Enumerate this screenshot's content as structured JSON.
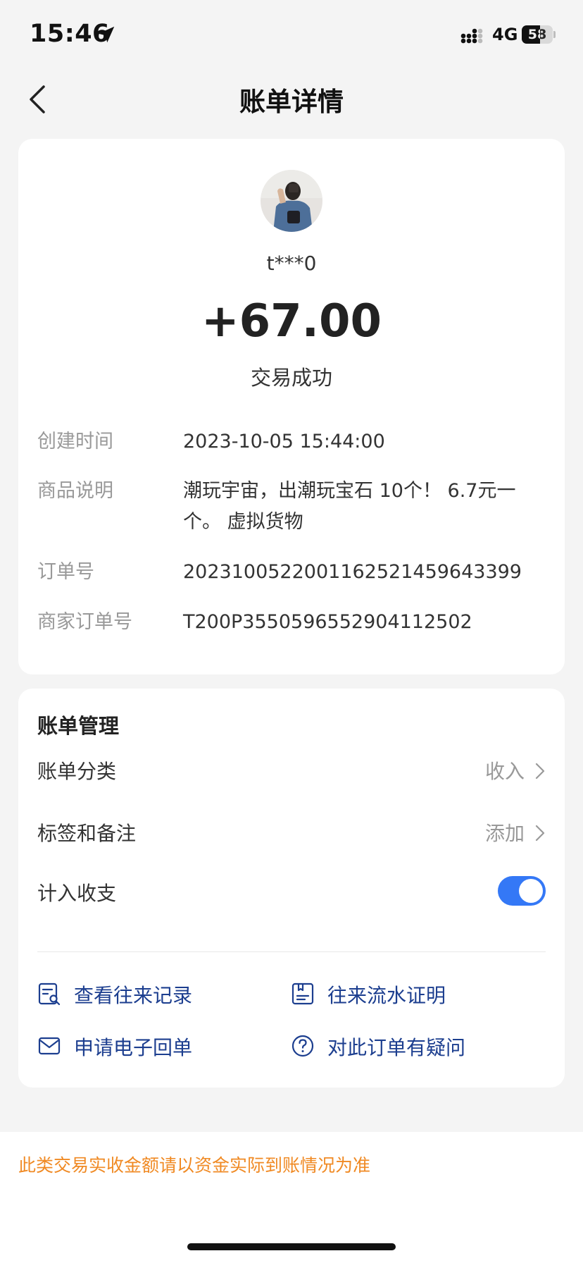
{
  "status_bar": {
    "time": "15:46",
    "network": "4G",
    "battery_level": "58",
    "battery_fraction": 0.58
  },
  "nav": {
    "title": "账单详情",
    "back_icon": "chevron-left-icon"
  },
  "transaction": {
    "payer_name": "t***0",
    "amount": "+67.00",
    "status": "交易成功",
    "details": [
      {
        "label": "创建时间",
        "value": "2023-10-05 15:44:00"
      },
      {
        "label": "商品说明",
        "value": "潮玩宇宙，出潮玩宝石 10个！ 6.7元一个。 虚拟货物"
      },
      {
        "label": "订单号",
        "value": "2023100522001162521459643399"
      },
      {
        "label": "商家订单号",
        "value": "T200P3550596552904112502"
      }
    ]
  },
  "manage": {
    "title": "账单管理",
    "category_label": "账单分类",
    "category_value": "收入",
    "tags_label": "标签和备注",
    "tags_value": "添加",
    "include_label": "计入收支",
    "include_enabled": true,
    "actions": [
      {
        "label": "查看往来记录",
        "icon": "records-search-icon"
      },
      {
        "label": "往来流水证明",
        "icon": "statement-proof-icon"
      },
      {
        "label": "申请电子回单",
        "icon": "envelope-icon"
      },
      {
        "label": "对此订单有疑问",
        "icon": "question-circle-icon"
      }
    ]
  },
  "notice": {
    "text": "此类交易实收金额请以资金实际到账情况为准"
  },
  "colors": {
    "accent_blue": "#3478f6",
    "action_blue": "#1c3e8f",
    "notice_orange": "#f08a24",
    "background": "#f4f4f4"
  }
}
